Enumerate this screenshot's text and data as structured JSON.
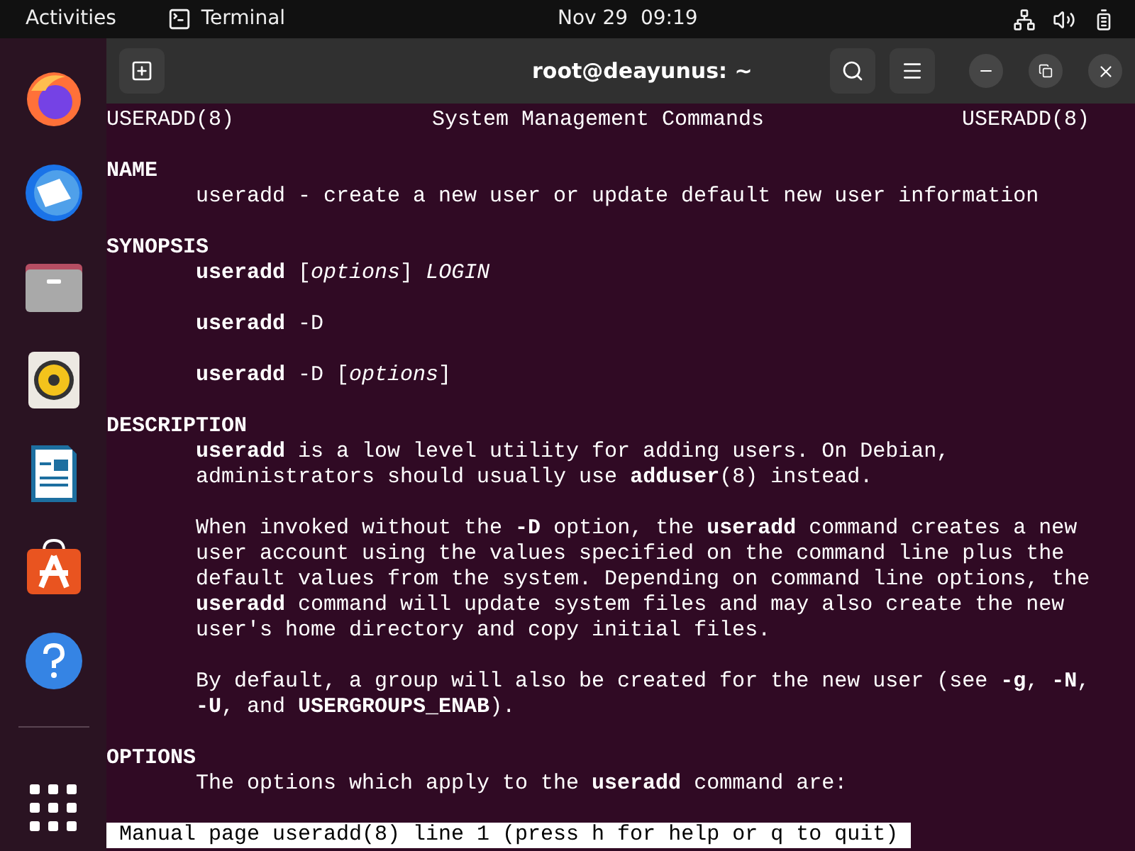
{
  "top_bar": {
    "activities": "Activities",
    "app_name": "Terminal",
    "clock": "Nov 29  09:19"
  },
  "window": {
    "title": "root@deayunus: ~"
  },
  "man_header": [
    "USERADD(8)",
    "System Management Commands",
    "USERADD(8)"
  ],
  "lines": [
    {
      "kind": "blank"
    },
    {
      "kind": "heading",
      "text": "NAME"
    },
    {
      "kind": "text",
      "text": "useradd - create a new user or update default new user information"
    },
    {
      "kind": "blank"
    },
    {
      "kind": "heading",
      "text": "SYNOPSIS"
    },
    {
      "kind": "text",
      "text": "**useradd** [*options*] *LOGIN*"
    },
    {
      "kind": "blank"
    },
    {
      "kind": "text",
      "text": "**useradd** -D"
    },
    {
      "kind": "blank"
    },
    {
      "kind": "text",
      "text": "**useradd** -D [*options*]"
    },
    {
      "kind": "blank"
    },
    {
      "kind": "heading",
      "text": "DESCRIPTION"
    },
    {
      "kind": "text",
      "text": "**useradd** is a low level utility for adding users. On Debian,"
    },
    {
      "kind": "text",
      "text": "administrators should usually use **adduser**(8) instead."
    },
    {
      "kind": "blank"
    },
    {
      "kind": "text",
      "text": "When invoked without the **-D** option, the **useradd** command creates a new"
    },
    {
      "kind": "text",
      "text": "user account using the values specified on the command line plus the"
    },
    {
      "kind": "text",
      "text": "default values from the system. Depending on command line options, the"
    },
    {
      "kind": "text",
      "text": "**useradd** command will update system files and may also create the new"
    },
    {
      "kind": "text",
      "text": "user's home directory and copy initial files."
    },
    {
      "kind": "blank"
    },
    {
      "kind": "text",
      "text": "By default, a group will also be created for the new user (see **-g**, **-N**,"
    },
    {
      "kind": "text",
      "text": "**-U**, and **USERGROUPS_ENAB**)."
    },
    {
      "kind": "blank"
    },
    {
      "kind": "heading",
      "text": "OPTIONS"
    },
    {
      "kind": "text",
      "text": "The options which apply to the **useradd** command are:"
    },
    {
      "kind": "blank"
    }
  ],
  "status_line": "Manual page useradd(8) line 1 (press h for help or q to quit)"
}
